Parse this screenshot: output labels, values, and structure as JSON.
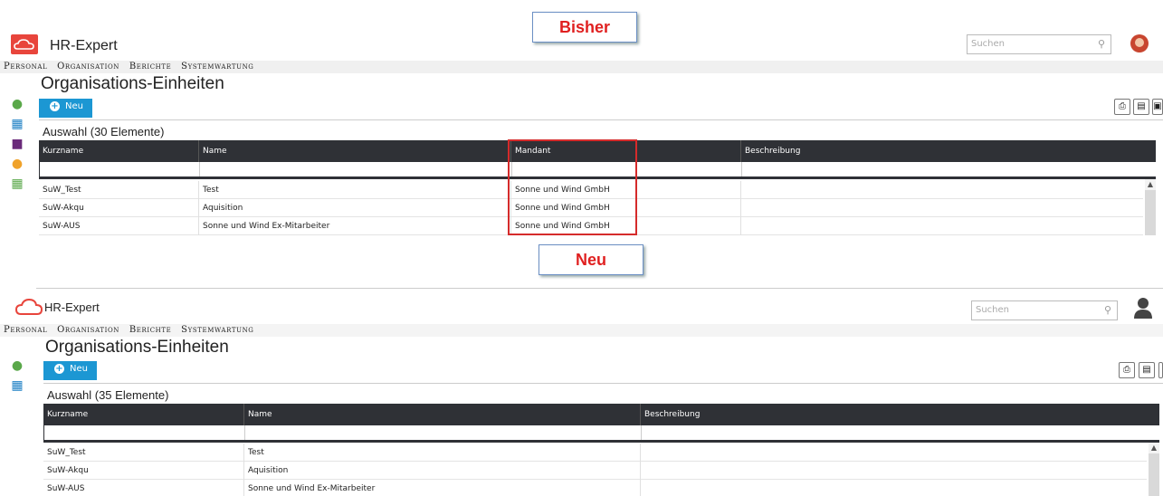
{
  "labels": {
    "top": "Bisher",
    "bottom": "Neu"
  },
  "colors": {
    "accent": "#1c97d3",
    "header": "#2f3136",
    "highlight": "#d52b2b",
    "callout_text": "#e02020"
  },
  "old": {
    "app_title": "HR-Expert",
    "search_placeholder": "Suchen",
    "menu": [
      "Personal",
      "Organisation",
      "Berichte",
      "Systemwartung"
    ],
    "page_title": "Organisations-Einheiten",
    "new_button": "Neu",
    "selection_title": "Auswahl (30 Elemente)",
    "columns": [
      "Kurzname",
      "Name",
      "Mandant",
      "Beschreibung"
    ],
    "rows": [
      [
        "SuW_Test",
        "Test",
        "Sonne und Wind GmbH",
        ""
      ],
      [
        "SuW-Akqu",
        "Aquisition",
        "Sonne und Wind GmbH",
        ""
      ],
      [
        "SuW-AUS",
        "Sonne und Wind Ex-Mitarbeiter",
        "Sonne und Wind GmbH",
        ""
      ]
    ]
  },
  "new": {
    "app_title": "HR-Expert",
    "search_placeholder": "Suchen",
    "menu": [
      "Personal",
      "Organisation",
      "Berichte",
      "Systemwartung"
    ],
    "page_title": "Organisations-Einheiten",
    "new_button": "Neu",
    "selection_title": "Auswahl (35 Elemente)",
    "columns": [
      "Kurzname",
      "Name",
      "Beschreibung"
    ],
    "rows": [
      [
        "SuW_Test",
        "Test",
        ""
      ],
      [
        "SuW-Akqu",
        "Aquisition",
        ""
      ],
      [
        "SuW-AUS",
        "Sonne und Wind Ex-Mitarbeiter",
        ""
      ]
    ]
  }
}
